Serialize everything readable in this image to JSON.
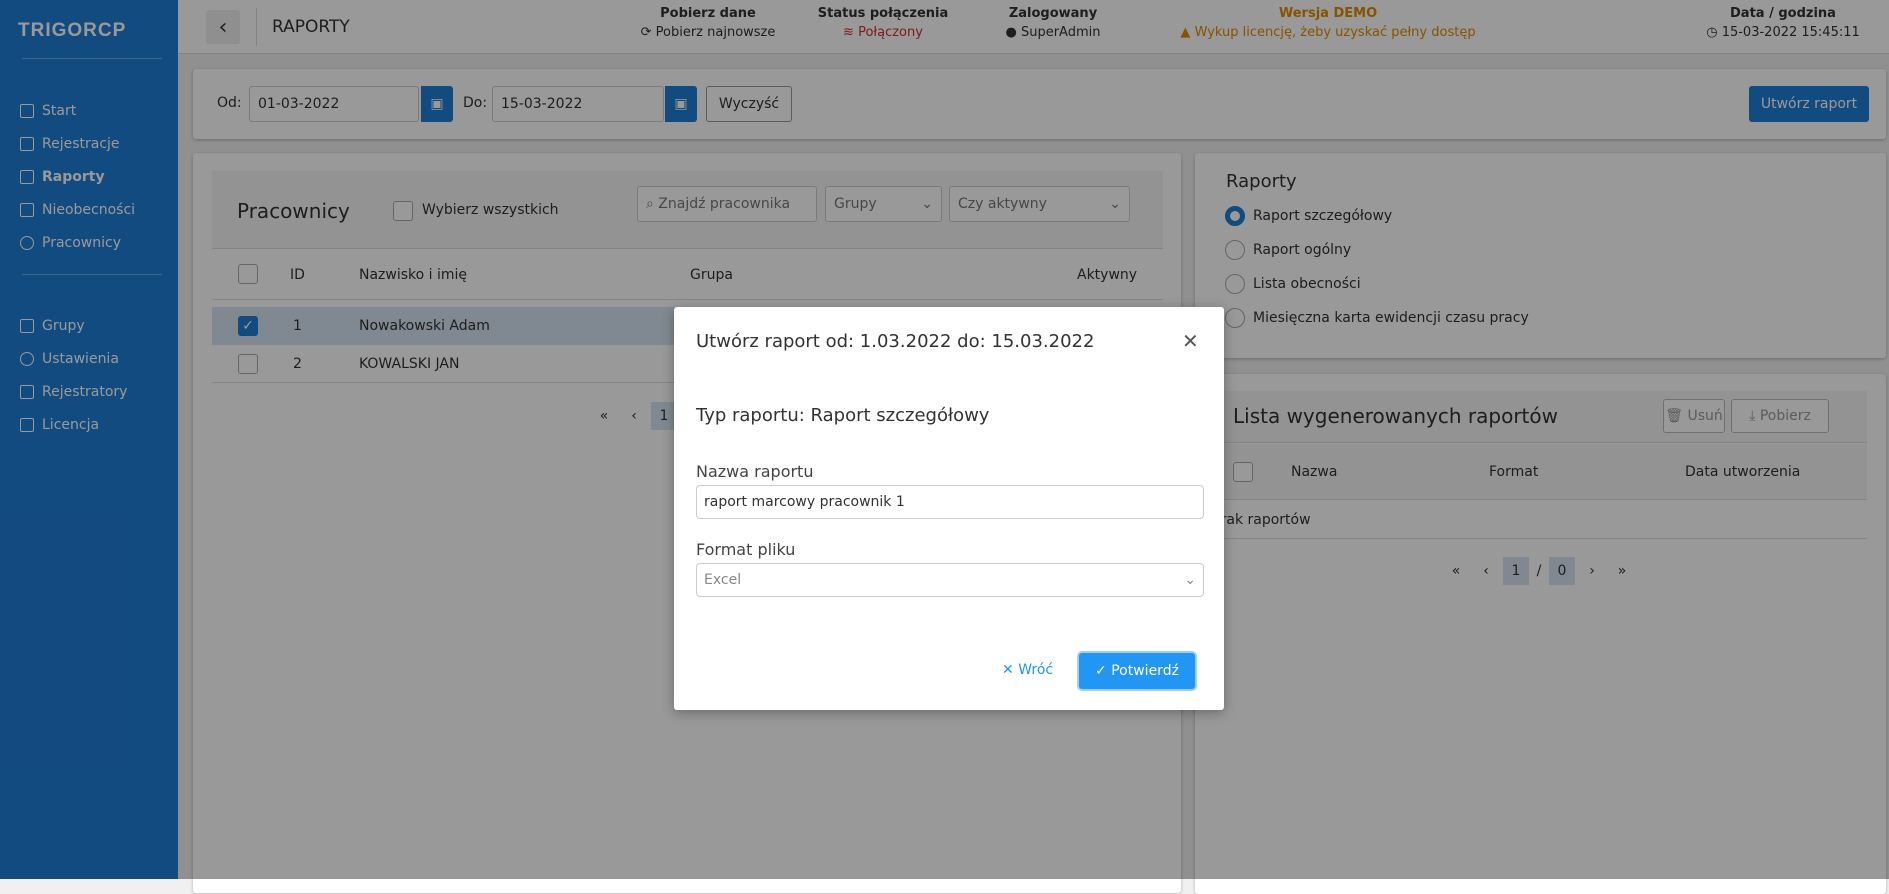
{
  "app": {
    "logo": "TRIGORCP",
    "page_title": "RAPORTY"
  },
  "sidebar": {
    "items": [
      {
        "label": "Start",
        "icon": "home-icon"
      },
      {
        "label": "Rejestracje",
        "icon": "grid-icon"
      },
      {
        "label": "Raporty",
        "icon": "file-icon",
        "active": true
      },
      {
        "label": "Nieobecności",
        "icon": "calendar-icon"
      },
      {
        "label": "Pracownicy",
        "icon": "user-icon"
      },
      {
        "label": "Grupy",
        "icon": "users-icon"
      },
      {
        "label": "Ustawienia",
        "icon": "gear-icon"
      },
      {
        "label": "Rejestratory",
        "icon": "device-icon"
      },
      {
        "label": "Licencja",
        "icon": "id-card-icon"
      }
    ]
  },
  "header": {
    "fetch": {
      "title": "Pobierz dane",
      "value": "Pobierz najnowsze"
    },
    "status": {
      "title": "Status połączenia",
      "value": "Połączony",
      "color": "#d32f2f"
    },
    "user": {
      "title": "Zalogowany",
      "value": "SuperAdmin"
    },
    "demo": {
      "title": "Wersja DEMO",
      "value": "Wykup licencję, żeby uzyskać pełny dostęp",
      "color": "#e08a00"
    },
    "datetime": {
      "title": "Data / godzina",
      "value": "15-03-2022 15:45:11"
    }
  },
  "filter": {
    "from_label": "Od:",
    "from_value": "01-03-2022",
    "to_label": "Do:",
    "to_value": "15-03-2022",
    "clear": "Wyczyść",
    "create": "Utwórz raport"
  },
  "employees": {
    "title": "Pracownicy",
    "select_all": "Wybierz wszystkich",
    "search_placeholder": "Znajdź pracownika",
    "groups": "Grupy",
    "active_filter": "Czy aktywny",
    "columns": [
      "ID",
      "Nazwisko i imię",
      "Grupa",
      "Aktywny"
    ],
    "rows": [
      {
        "id": "1",
        "name": "Nowakowski Adam",
        "checked": true
      },
      {
        "id": "2",
        "name": "KOWALSKI JAN",
        "checked": false
      }
    ],
    "page": "1"
  },
  "reports": {
    "title": "Raporty",
    "options": [
      "Raport szczegółowy",
      "Raport ogólny",
      "Lista obecności",
      "Miesięczna karta ewidencji czasu pracy"
    ],
    "selected": 0
  },
  "generated": {
    "title": "Lista wygenerowanych raportów",
    "delete": "Usuń",
    "download": "Pobierz",
    "columns": [
      "Nazwa",
      "Format",
      "Data utworzenia"
    ],
    "empty": "Brak raportów",
    "page": "1",
    "sep": "/",
    "total": "0"
  },
  "modal": {
    "title": "Utwórz raport od: 1.03.2022 do: 15.03.2022",
    "type": "Typ raportu: Raport szczegółowy",
    "name_label": "Nazwa raportu",
    "name_value": "raport marcowy pracownik 1",
    "format_label": "Format pliku",
    "format_value": "Excel",
    "back": "Wróć",
    "confirm": "Potwierdź"
  }
}
